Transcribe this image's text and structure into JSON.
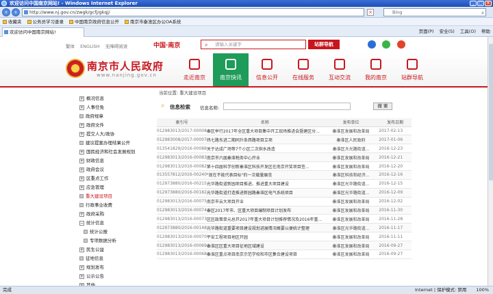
{
  "browser": {
    "title": "欢迎访问中国南京网站! - Windows Internet Explorer",
    "address": "http://www.nj.gov.cn/zwgk/gcfj/gkqj/",
    "search_placeholder": "Bing",
    "favorites_label": "收藏夹",
    "favorites": [
      "公务员学习查录",
      "中国南京政府信息公开",
      "南京市秦淮区办公OA系统"
    ],
    "tab_title": "欢迎访问中国南京网站!",
    "commands": [
      "页面(P)",
      "安全(S)",
      "工具(O)",
      "帮助"
    ],
    "status_left": "完成",
    "status_zone": "Internet | 保护模式: 禁用",
    "zoom": "100%"
  },
  "site": {
    "top_links": [
      "繁体",
      "ENGLISH",
      "无障碍阅读"
    ],
    "brand": "中国·南京",
    "search_placeholder": "请输入关键字",
    "nav_button": "站群导航",
    "title": "南京市人民政府",
    "url": "www.nanjing.gov.cn",
    "nav": [
      "走近南京",
      "南京快讯",
      "信息公开",
      "在线服务",
      "互动交流",
      "我的南京",
      "站群导航"
    ],
    "active_nav": "南京快讯",
    "accent": "#c8161d",
    "active_color": "#1f9b5a"
  },
  "breadcrumb": "当前位置: 重大建设项目",
  "sidebar": [
    {
      "label": "概况信息",
      "kind": "plus"
    },
    {
      "label": "人事任免",
      "kind": "plus"
    },
    {
      "label": "政府规章",
      "kind": "leaf"
    },
    {
      "label": "政府文件",
      "kind": "plus"
    },
    {
      "label": "提交人大/政协",
      "kind": "plus"
    },
    {
      "label": "建议提案办理结果公开",
      "kind": "leaf"
    },
    {
      "label": "国民经济和社会发展规划",
      "kind": "plus"
    },
    {
      "label": "财政信息",
      "kind": "plus"
    },
    {
      "label": "政府会议",
      "kind": "plus"
    },
    {
      "label": "区重点工作",
      "kind": "plus"
    },
    {
      "label": "应急管理",
      "kind": "plus"
    },
    {
      "label": "重大建设项目",
      "kind": "leaf",
      "active": true
    },
    {
      "label": "行政事业收费",
      "kind": "leaf"
    },
    {
      "label": "政府采购",
      "kind": "plus"
    },
    {
      "label": "统计信息",
      "kind": "minus"
    },
    {
      "label": "统计公报",
      "kind": "leaf",
      "indent": true
    },
    {
      "label": "专项数据分析",
      "kind": "leaf",
      "indent": true
    },
    {
      "label": "民生公益",
      "kind": "plus"
    },
    {
      "label": "征地信息",
      "kind": "leaf"
    },
    {
      "label": "规划发布",
      "kind": "plus"
    },
    {
      "label": "公示公告",
      "kind": "plus"
    },
    {
      "label": "其他",
      "kind": "plus"
    }
  ],
  "search": {
    "section_label": "信息检索",
    "keyword_label": "信息名称:",
    "button": "搜 索"
  },
  "table": {
    "headers": [
      "索引号",
      "名称",
      "发布单位",
      "发布日期"
    ],
    "rows": [
      [
        "012983013/2017-00008",
        "秦区举行2017年全区重大项目集中开工现场推进会暨建区分...",
        "秦淮区发展和改革局",
        "2017-02-13"
      ],
      [
        "012983008/2017-00007",
        "纬七路东进二期同升条西路项目立项",
        "秦淮区人民政府",
        "2017-01-06"
      ],
      [
        "013541829/2016-00088",
        "关于达成广场等7个小区二次供水改造",
        "秦淮区大光路街道...",
        "2016-12-23"
      ],
      [
        "012983013/2016-00083",
        "南京市六届秦淮税务中心开业",
        "秦淮区发展和改革局",
        "2016-12-21"
      ],
      [
        "012983013/2016-00082",
        "第十四届科学创新秦淮区科技开发区在南京开奖项目签...",
        "秦淮区发展和改革局",
        "2016-12-20"
      ],
      [
        "013557812/2016-00240",
        "\"现在不能代表目标\"的一次载量展览",
        "秦淮区科技和经济...",
        "2016-12-16"
      ],
      [
        "012973880/2016-00215",
        "光华路街道新园项目推进、推进重大项目建设",
        "秦淮区光华路街道...",
        "2016-12-15"
      ],
      [
        "012973880/2016-00182",
        "光华路街道打造推进新园路秦淮区电气系统项目",
        "秦淮区光华路街道...",
        "2016-12-09"
      ],
      [
        "012983013/2016-00075",
        "南京市云大项目开业",
        "秦淮区发展和改革局",
        "2016-12-02"
      ],
      [
        "012983013/2016-00074",
        "秦区2017年市、区重大项目编制项目计划发布",
        "秦淮区发展和改革局",
        "2016-11-30"
      ],
      [
        "012983013/2016-00073",
        "区区政策单元总开2017年重大项目计划推荐情况及2016年重...",
        "秦淮区发展和改革局",
        "2016-11-28"
      ],
      [
        "012973880/2016-00148",
        "光华路街道重要项目建设规划进展情况概要以便统计整理",
        "秦淮区光华路街道...",
        "2016-11-17"
      ],
      [
        "012983013/2016-00070",
        "平安工程项目地区开园",
        "秦淮区发展和改革局",
        "2016-11-11"
      ],
      [
        "012983013/2016-00069",
        "秦淮区区重大项目征地区域建设",
        "秦淮区发展和改革局",
        "2016-09-27"
      ],
      [
        "012983013/2016-00068",
        "秦淮区重点项目南京示范学校和市区集合建设项目",
        "秦淮区发展和改革局",
        "2016-09-27"
      ]
    ]
  }
}
